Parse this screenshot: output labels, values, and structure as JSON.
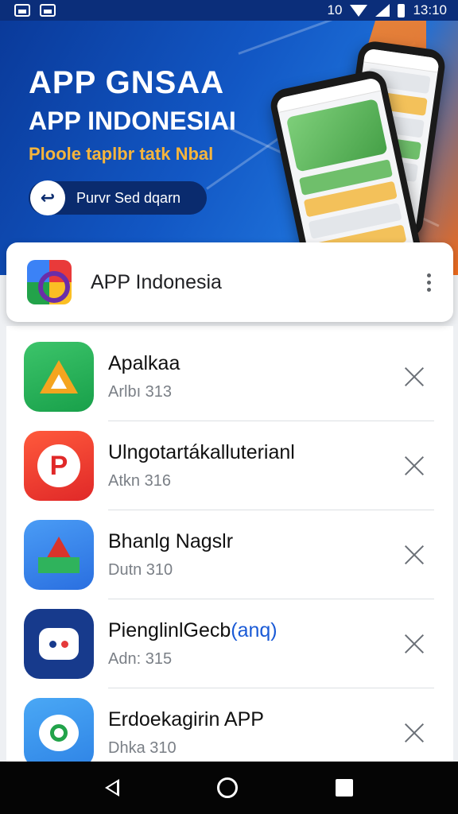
{
  "status_bar": {
    "time": "13:10",
    "network": "10"
  },
  "banner": {
    "title_line1": "APP GNSAA",
    "title_line2": "APP INDONESIAI",
    "subtitle": "Ploole taplbr tatk Nbal",
    "cta_label": "Purvr Sed dqarn",
    "cta_icon": "arrow-icon"
  },
  "app_header": {
    "title": "APP Indonesia"
  },
  "apps": [
    {
      "name": "Apalkaa",
      "sub": "Arlbı 313",
      "icon": "green-triangle-icon"
    },
    {
      "name": "Ulngotartákalluterianl",
      "sub": "Atkn 316",
      "icon": "red-p-icon"
    },
    {
      "name": "Bhanlg Nagslr",
      "sub": "Dutn 310",
      "icon": "blue-triangle-icon"
    },
    {
      "name": "PienglinlGecb",
      "name_accent": "(anq)",
      "sub": "Adn: 315",
      "icon": "chat-bubble-icon"
    },
    {
      "name": "Erdoekagirin APP",
      "sub": "Dhka 310",
      "icon": "green-bubble-icon"
    }
  ],
  "colors": {
    "banner_blue": "#1257c4",
    "accent_orange": "#f06a1a",
    "subtitle_gold": "#f6b53c"
  }
}
